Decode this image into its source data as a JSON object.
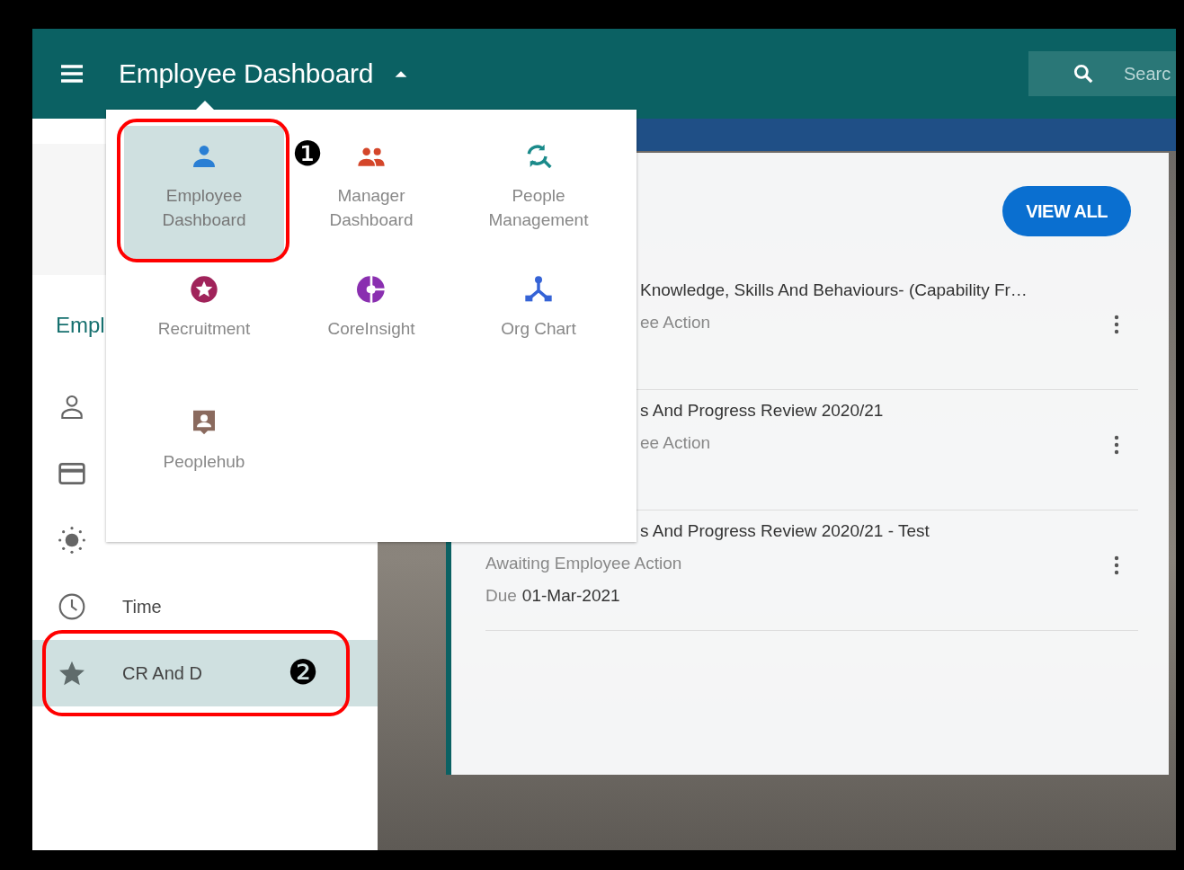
{
  "header": {
    "title": "Employee Dashboard",
    "search": {
      "placeholder": "Searc"
    }
  },
  "app_menu": {
    "items": [
      {
        "label": "Employee Dashboard",
        "color": "#2a7fd4",
        "selected": true
      },
      {
        "label": "Manager Dashboard",
        "color": "#d4462a",
        "selected": false
      },
      {
        "label": "People Management",
        "color": "#1a8a8a",
        "selected": false
      },
      {
        "label": "Recruitment",
        "color": "#a0235a",
        "selected": false
      },
      {
        "label": "CoreInsight",
        "color": "#8a2fb0",
        "selected": false
      },
      {
        "label": "Org Chart",
        "color": "#3563d6",
        "selected": false
      },
      {
        "label": "Peoplehub",
        "color": "#8a6a5e",
        "selected": false
      }
    ]
  },
  "sidebar": {
    "heading": "Empl",
    "items": [
      {
        "selected": false
      },
      {
        "selected": false
      },
      {
        "selected": false
      },
      {
        "label": "Time",
        "selected": false
      },
      {
        "label": "CR And D",
        "selected": true
      }
    ]
  },
  "card": {
    "button": "VIEW ALL",
    "rows": [
      {
        "title": "Knowledge, Skills And Behaviours- (Capability Fr…",
        "title_covered": true,
        "status": "ee Action",
        "status_covered": true
      },
      {
        "title": "s And Progress Review 2020/21",
        "title_covered": true,
        "status": "ee Action",
        "status_covered": true
      },
      {
        "title": "s And Progress Review 2020/21 - Test",
        "title_covered": true,
        "status": "Awaiting Employee Action",
        "status_covered": false,
        "due_label": "Due",
        "due_date": "01-Mar-2021"
      }
    ]
  },
  "annotations": [
    {
      "number": "❶"
    },
    {
      "number": "❷"
    }
  ]
}
